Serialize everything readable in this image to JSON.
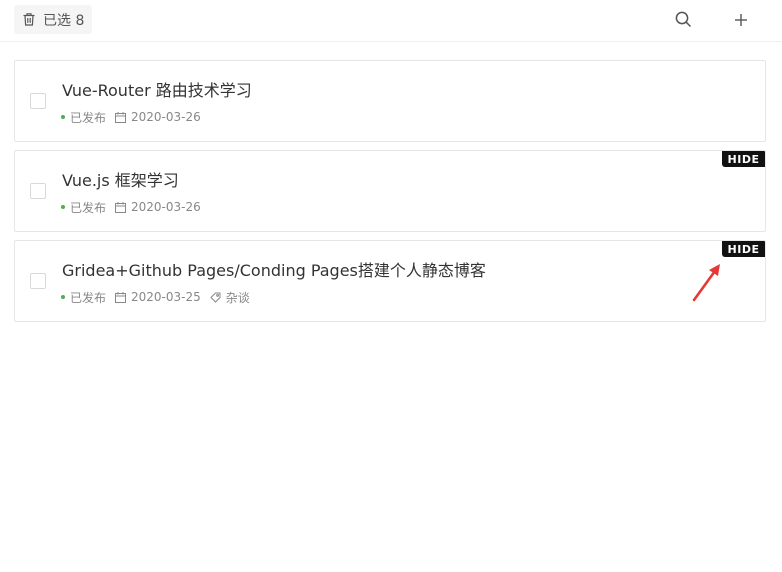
{
  "toolbar": {
    "selected_label": "已选 8",
    "trash_icon": "trash-icon",
    "search_icon": "search-icon",
    "add_icon": "plus-icon"
  },
  "posts": [
    {
      "title": "Vue-Router 路由技术学习",
      "status": "已发布",
      "date": "2020-03-26",
      "tag": null,
      "hidden_badge": null
    },
    {
      "title": "Vue.js 框架学习",
      "status": "已发布",
      "date": "2020-03-26",
      "tag": null,
      "hidden_badge": "HIDE"
    },
    {
      "title": "Gridea+Github Pages/Conding Pages搭建个人静态博客",
      "status": "已发布",
      "date": "2020-03-25",
      "tag": "杂谈",
      "hidden_badge": "HIDE"
    }
  ],
  "colors": {
    "status_dot": "#4caf50",
    "badge_bg": "#111111",
    "arrow": "#e53935"
  }
}
